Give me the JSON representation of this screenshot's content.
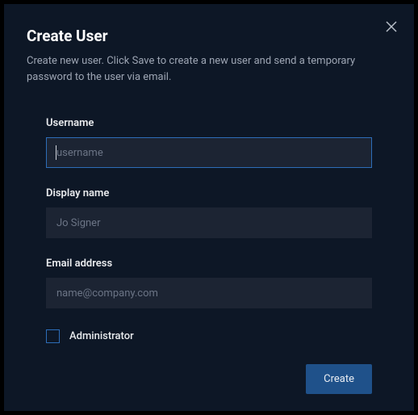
{
  "modal": {
    "title": "Create User",
    "description": "Create new user. Click Save to create a new user and send a temporary password to the user via email.",
    "close_icon": "close"
  },
  "fields": {
    "username": {
      "label": "Username",
      "placeholder": "username",
      "value": ""
    },
    "display_name": {
      "label": "Display name",
      "placeholder": "Jo Signer",
      "value": ""
    },
    "email": {
      "label": "Email address",
      "placeholder": "name@company.com",
      "value": ""
    }
  },
  "checkbox": {
    "administrator_label": "Administrator",
    "checked": false
  },
  "actions": {
    "create_label": "Create"
  }
}
